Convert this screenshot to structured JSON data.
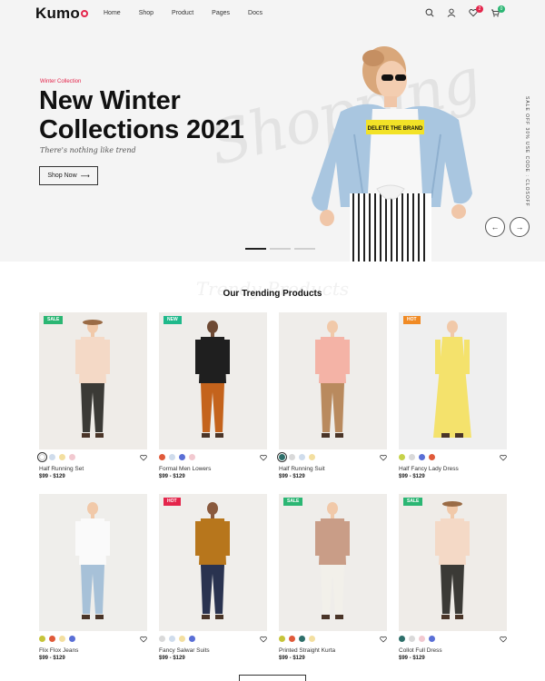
{
  "header": {
    "logo": "Kumo",
    "nav": [
      {
        "label": "Home",
        "dropdown": false
      },
      {
        "label": "Shop",
        "dropdown": false
      },
      {
        "label": "Product",
        "dropdown": false
      },
      {
        "label": "Pages",
        "dropdown": false
      },
      {
        "label": "Docs",
        "dropdown": false
      }
    ],
    "wishlist_count": "2",
    "cart_count": "0",
    "icons": [
      "search-icon",
      "user-icon",
      "heart-icon",
      "cart-icon"
    ]
  },
  "hero": {
    "subtitle": "Winter Collection",
    "title_line1": "New Winter",
    "title_line2": "Collections 2021",
    "tagline": "There's nothing like trend",
    "button_label": "Shop Now",
    "watermark": "Shopping",
    "side_text": "SALE OFF 30% USE CODE : CLOSOFF",
    "accent_color": "#e4254b"
  },
  "trending": {
    "title": "Our Trending Products",
    "background_title": "Trendy Products",
    "products": [
      {
        "name": "Half Running Set",
        "price": "$99 - $129",
        "tag": "SALE",
        "tag_color": "#2bb673",
        "swatches": [
          "#ffffff",
          "#cfdcec",
          "#f3dfa0",
          "#f2c9d0"
        ],
        "selected": 0
      },
      {
        "name": "Formal Men Lowers",
        "price": "$99 - $129",
        "tag": "NEW",
        "tag_color": "#1fb98b",
        "swatches": [
          "#e05a3a",
          "#cfdcec",
          "#5a6fd6",
          "#f2c9d0"
        ],
        "selected": -1
      },
      {
        "name": "Half Running Suit",
        "price": "$99 - $129",
        "tag": "",
        "tag_color": "",
        "swatches": [
          "#2e6f6a",
          "#d9d9d9",
          "#cfdcec",
          "#f3dfa0"
        ],
        "selected": 0
      },
      {
        "name": "Half Fancy Lady Dress",
        "price": "$99 - $129",
        "tag": "HOT",
        "tag_color": "#f08a24",
        "swatches": [
          "#c6d24a",
          "#d9d9d9",
          "#5a6fd6",
          "#e05a3a"
        ],
        "selected": -1
      },
      {
        "name": "Flix Flox Jeans",
        "price": "$99 - $129",
        "tag": "",
        "tag_color": "",
        "swatches": [
          "#c6c43a",
          "#e05a3a",
          "#f3dfa0",
          "#5a6fd6"
        ],
        "selected": -1
      },
      {
        "name": "Fancy Salwar Suits",
        "price": "$99 - $129",
        "tag": "HOT",
        "tag_color": "#e4254b",
        "swatches": [
          "#d9d9d9",
          "#cfdcec",
          "#f3dfa0",
          "#5a6fd6"
        ],
        "selected": -1
      },
      {
        "name": "Printed Straight Kurta",
        "price": "$99 - $129",
        "tag": "SALE",
        "tag_color": "#2bb673",
        "swatches": [
          "#c6c43a",
          "#e05a3a",
          "#2e6f6a",
          "#f3dfa0"
        ],
        "selected": -1
      },
      {
        "name": "Collot Full Dress",
        "price": "$99 - $129",
        "tag": "SALE",
        "tag_color": "#2bb673",
        "swatches": [
          "#2e6f6a",
          "#d9d9d9",
          "#f2c9d0",
          "#5a6fd6"
        ],
        "selected": -1
      }
    ]
  }
}
